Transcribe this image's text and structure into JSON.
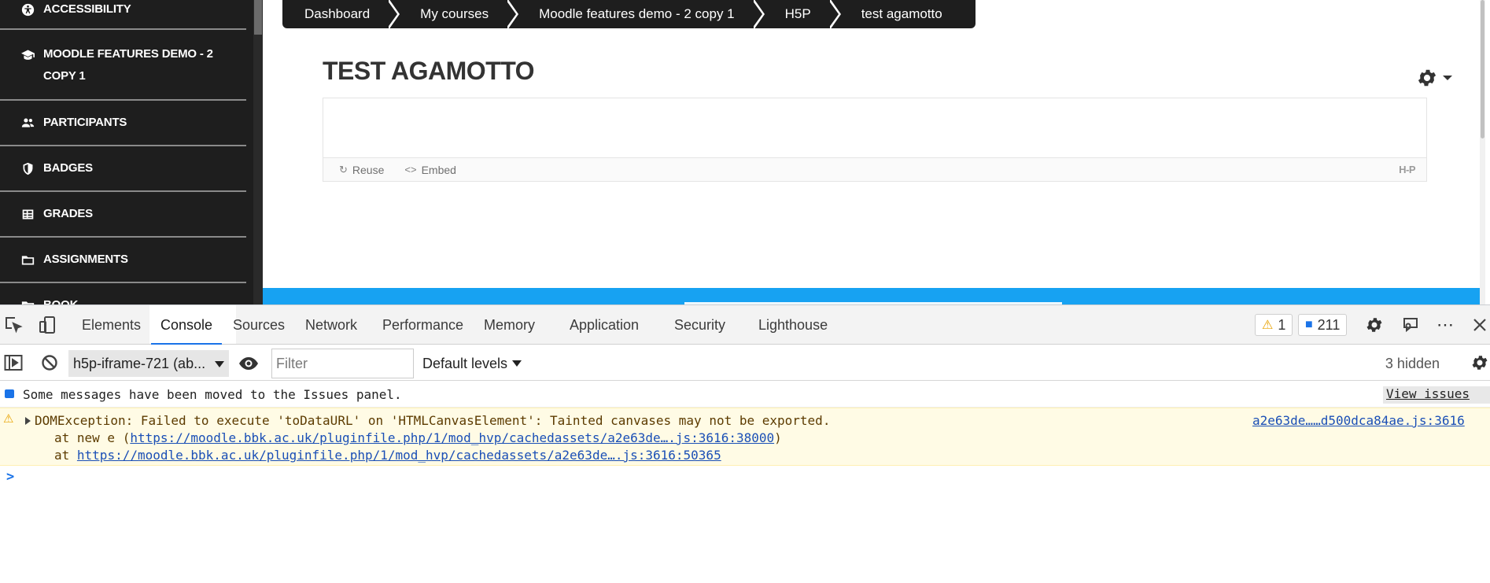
{
  "sidebar": {
    "items": [
      {
        "label": "ACCESSIBILITY",
        "icon": "universal-access-icon"
      },
      {
        "label": "MOODLE FEATURES DEMO - 2 COPY 1",
        "line1": "MOODLE FEATURES DEMO - 2",
        "line2": "COPY 1",
        "icon": "graduation-cap-icon"
      },
      {
        "label": "PARTICIPANTS",
        "icon": "users-icon"
      },
      {
        "label": "BADGES",
        "icon": "shield-icon"
      },
      {
        "label": "GRADES",
        "icon": "table-icon"
      },
      {
        "label": "ASSIGNMENTS",
        "icon": "folder-icon"
      },
      {
        "label": "BOOK",
        "icon": "folder-icon"
      }
    ]
  },
  "breadcrumb": [
    "Dashboard",
    "My courses",
    "Moodle features demo - 2 copy 1",
    "H5P",
    "test agamotto"
  ],
  "page": {
    "title": "TEST AGAMOTTO",
    "h5p": {
      "reuse_label": "Reuse",
      "embed_label": "Embed",
      "logo_text": "H-P"
    }
  },
  "devtools": {
    "tabs": [
      "Elements",
      "Console",
      "Sources",
      "Network",
      "Performance",
      "Memory",
      "Application",
      "Security",
      "Lighthouse"
    ],
    "active_tab": "Console",
    "warnings_count": "1",
    "messages_count": "211",
    "context": "h5p-iframe-721 (ab...",
    "filter_placeholder": "Filter",
    "levels": "Default levels",
    "hidden": "3 hidden"
  },
  "console": {
    "info_message": "Some messages have been moved to the Issues panel.",
    "view_issues": "View issues",
    "warning": {
      "message": "DOMException: Failed to execute 'toDataURL' on 'HTMLCanvasElement': Tainted canvases may not be exported.",
      "source": "a2e63de……d500dca84ae.js:3616",
      "stack1_prefix": "at new e (",
      "stack1_link": "https://moodle.bbk.ac.uk/pluginfile.php/1/mod_hvp/cachedassets/a2e63de….js:3616:38000",
      "stack1_suffix": ")",
      "stack2_prefix": "at ",
      "stack2_link": "https://moodle.bbk.ac.uk/pluginfile.php/1/mod_hvp/cachedassets/a2e63de….js:3616:50365"
    },
    "prompt": ">"
  },
  "colors": {
    "sidebar_bg": "#1e1e1e",
    "breadcrumb_bg": "#1e1e1e",
    "accent_blue": "#17a2f2",
    "devtools_tab_underline": "#1a73e8",
    "warning_bg": "#fffbe5"
  }
}
